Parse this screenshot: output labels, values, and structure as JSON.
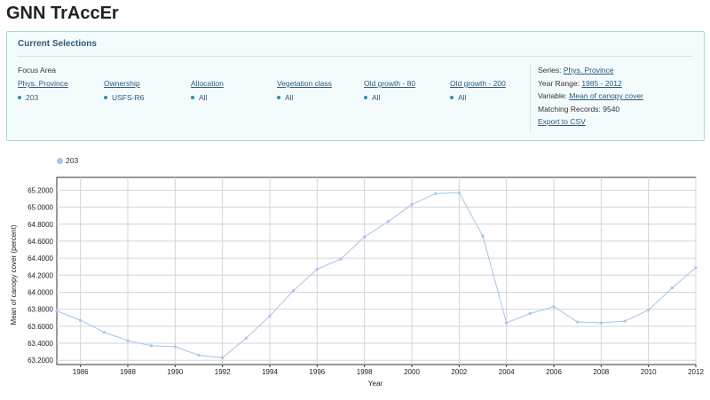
{
  "app": {
    "title": "GNN TrAccEr"
  },
  "selections": {
    "heading": "Current Selections",
    "focus_label": "Focus Area",
    "columns": [
      {
        "label": "Phys. Province",
        "value": "203"
      },
      {
        "label": "Ownership",
        "value": "USFS-R6"
      },
      {
        "label": "Allocation",
        "value": "All"
      },
      {
        "label": "Vegetation class",
        "value": "All"
      },
      {
        "label": "Old growth - 80",
        "value": "All"
      },
      {
        "label": "Old growth - 200",
        "value": "All"
      }
    ],
    "series_label": "Series:",
    "series_value": "Phys. Province",
    "year_range_label": "Year Range:",
    "year_range_value": "1985 - 2012",
    "variable_label": "Variable:",
    "variable_value": "Mean of canopy cover",
    "matching_label": "Matching Records:",
    "matching_value": "9540",
    "export_label": "Export to CSV"
  },
  "colors": {
    "series": "#a8c4e8",
    "link": "#2b5a7a",
    "panel_border": "#a9d9e0"
  },
  "chart_data": {
    "type": "line",
    "title": "",
    "xlabel": "Year",
    "ylabel": "Mean of canopy cover (percent)",
    "legend_position": "top-left",
    "grid": true,
    "xlim": [
      1985,
      2012
    ],
    "ylim": [
      63.15,
      65.35
    ],
    "x_ticks": [
      1986,
      1988,
      1990,
      1992,
      1994,
      1996,
      1998,
      2000,
      2002,
      2004,
      2006,
      2008,
      2010,
      2012
    ],
    "y_ticks": [
      "63.2000",
      "63.4000",
      "63.6000",
      "63.8000",
      "64.0000",
      "64.2000",
      "64.4000",
      "64.6000",
      "64.8000",
      "65.0000",
      "65.2000"
    ],
    "series": [
      {
        "name": "203",
        "x": [
          1985,
          1986,
          1987,
          1988,
          1989,
          1990,
          1991,
          1992,
          1993,
          1994,
          1995,
          1996,
          1997,
          1998,
          1999,
          2000,
          2001,
          2002,
          2003,
          2004,
          2005,
          2006,
          2007,
          2008,
          2009,
          2010,
          2011,
          2012
        ],
        "values": [
          63.78,
          63.67,
          63.53,
          63.43,
          63.37,
          63.36,
          63.26,
          63.23,
          63.46,
          63.72,
          64.02,
          64.27,
          64.39,
          64.65,
          64.83,
          65.03,
          65.16,
          65.17,
          64.66,
          63.64,
          63.75,
          63.83,
          63.65,
          63.64,
          63.66,
          63.79,
          64.05,
          64.29
        ]
      }
    ]
  }
}
